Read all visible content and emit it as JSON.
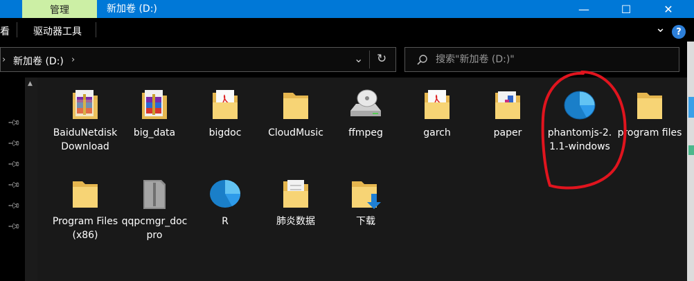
{
  "titlebar": {
    "manage_tab": "管理",
    "title": "新加卷 (D:)",
    "minimize": "—",
    "maximize": "☐",
    "close": "✕"
  },
  "ribbon": {
    "view_tab": "看",
    "drive_tools_tab": "驱动器工具",
    "expand_chevron": "⌄",
    "help": "?"
  },
  "address": {
    "back_arrow": "›",
    "path": "新加卷 (D:)",
    "path_arrow": "›",
    "dropdown": "⌄",
    "refresh": "↻"
  },
  "search": {
    "placeholder": "搜索\"新加卷 (D:)\"",
    "icon": "search-icon"
  },
  "nav": {
    "pins": [
      "pin-icon",
      "pin-icon",
      "pin-icon",
      "pin-icon",
      "pin-icon",
      "pin-icon"
    ]
  },
  "files": [
    {
      "label": "BaiduNetdiskDownload",
      "icon": "winrar-folder"
    },
    {
      "label": "big_data",
      "icon": "winrar-folder"
    },
    {
      "label": "bigdoc",
      "icon": "pdf-folder"
    },
    {
      "label": "CloudMusic",
      "icon": "folder"
    },
    {
      "label": "ffmpeg",
      "icon": "drive-disc"
    },
    {
      "label": "garch",
      "icon": "pdf-folder"
    },
    {
      "label": "paper",
      "icon": "document-folder"
    },
    {
      "label": "phantomjs-2.1.1-windows",
      "icon": "blue-pie"
    },
    {
      "label": "program files",
      "icon": "folder"
    },
    {
      "label": "Program Files (x86)",
      "icon": "folder"
    },
    {
      "label": "qqpcmgr_docpro",
      "icon": "archive-folder"
    },
    {
      "label": "R",
      "icon": "blue-pie"
    },
    {
      "label": "肺炎数据",
      "icon": "document-folder"
    },
    {
      "label": "下载",
      "icon": "download-folder"
    }
  ],
  "colors": {
    "titlebar": "#0078d7",
    "manage_tab": "#ccefa5",
    "folder": "#f7d475",
    "annotation": "#e0141e"
  }
}
